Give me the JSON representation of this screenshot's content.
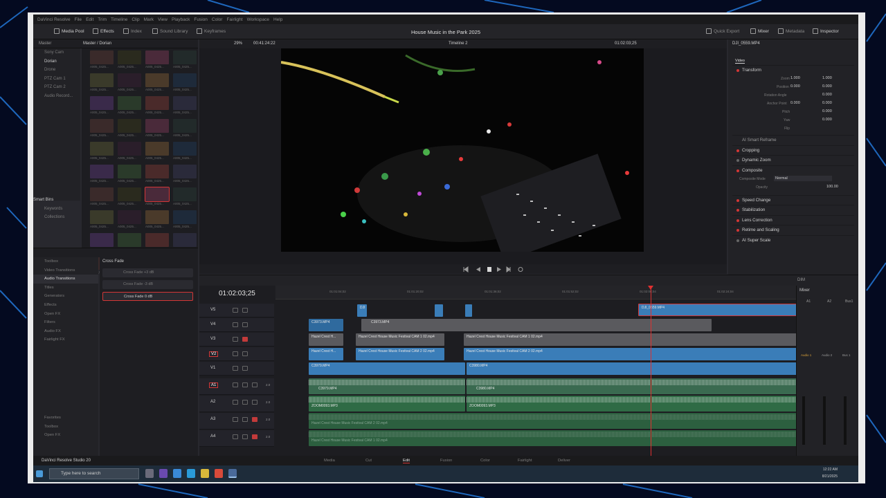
{
  "window": {
    "title_bar": "DaVinci Resolve",
    "menu": [
      "File",
      "Edit",
      "Trim",
      "Timeline",
      "Clip",
      "Mark",
      "View",
      "Playback",
      "Fusion",
      "Color",
      "Fairlight",
      "Workspace",
      "Help"
    ],
    "project_title": "House Music in the Park 2025"
  },
  "toolbar": {
    "media_pool": "Media Pool",
    "effects": "Effects",
    "index": "Index",
    "sound_library": "Sound Library",
    "keyframes": "Keyframes",
    "quick_export": "Quick Export",
    "mixer": "Mixer",
    "metadata": "Metadata",
    "inspector": "Inspector"
  },
  "media_pool": {
    "master": "Master",
    "breadcrumb": "Master / Dorian",
    "bins": [
      "Sony Cam",
      "Dorian",
      "Drone",
      "PTZ Cam 1",
      "PTZ Cam 2",
      "Audio Record..."
    ],
    "smart_bins": "Smart Bins",
    "smart_items": [
      "Keywords",
      "Collections"
    ],
    "clip_label": "A005_0425...",
    "selected_clip_label": "A005_0425..."
  },
  "viewer": {
    "zoom": "29%",
    "source_tc": "00:41:24:22",
    "timeline_name": "Timeline 2",
    "record_tc": "01:02:03;25"
  },
  "effects": {
    "tree": [
      "Toolbox",
      "Video Transitions",
      "Audio Transitions",
      "Titles",
      "Generators",
      "Effects",
      "Open FX",
      "Filters",
      "Audio FX",
      "Fairlight FX",
      "Favorites",
      "Toolbox",
      "Open FX"
    ],
    "category": "Cross Fade",
    "items": [
      "Cross Fade +3 dB",
      "Cross Fade -3 dB",
      "Cross Fade 0 dB"
    ]
  },
  "inspector": {
    "clip_name": "DJI_0559.MP4",
    "tab": "Video",
    "transform": "Transform",
    "zoom_label": "Zoom",
    "zoom_x": "1.000",
    "zoom_y": "1.000",
    "position_label": "Position",
    "pos_x": "0.000",
    "pos_y": "0.000",
    "rotation_label": "Rotation Angle",
    "rotation": "0.000",
    "anchor_label": "Anchor Point",
    "anchor_x": "0.000",
    "anchor_y": "0.000",
    "pitch_label": "Pitch",
    "pitch": "0.000",
    "yaw_label": "Yaw",
    "yaw": "0.000",
    "flip_label": "Flip",
    "ai_reframe": "AI Smart Reframe",
    "sections": [
      "Cropping",
      "Dynamic Zoom",
      "Composite"
    ],
    "composite_mode_label": "Composite Mode",
    "composite_mode": "Normal",
    "opacity_label": "Opacity",
    "opacity": "100.00",
    "sections2": [
      "Speed Change",
      "Stabilization",
      "Lens Correction",
      "Retime and Scaling",
      "AI Super Scale"
    ]
  },
  "timeline": {
    "timecode": "01:02:03;25",
    "ruler": [
      "01:01:04;02",
      "01:01:20;02",
      "01:01:36;02",
      "01:01:52;02",
      "01:02:08;04",
      "01:02:24;04"
    ],
    "tracks": [
      "V5",
      "V4",
      "V3",
      "V2",
      "V1",
      "A1",
      "A2",
      "A3",
      "A4"
    ],
    "vols": [
      "2.0",
      "2.0",
      "2.0",
      "2.0"
    ],
    "clips": {
      "v4a": "C3973.MP4",
      "v4b": "C3973.MP4",
      "v5a": "DJI",
      "v5b": "DJI_0559.MP4",
      "v3a": "Hazel Crest H...",
      "v3b": "Hazel Crest House Music Festival CAM 1 02.mp4",
      "v3c": "Hazel Crest House Music Festival CAM 1 02.mp4",
      "v2a": "Hazel Crest H...",
      "v2b": "Hazel Crest House Music Festival CAM 2 02.mp4",
      "v2c": "Hazel Crest House Music Festival CAM 2 02.mp4",
      "v1a": "C3979.MP4",
      "v1b": "C3980.MP4",
      "a1a": "C3979.MP4",
      "a1b": "C3980.MP4",
      "a2a": "ZOOM0093.MP3",
      "a2b": "ZOOM0093.MP3",
      "a3a": "Hazel Crest House Music Festival CAM 2 02.mp4",
      "a4a": "Hazel Crest House Music Festival CAM 1 02.mp4"
    }
  },
  "mixer": {
    "title": "Mixer",
    "dim": "DIM",
    "channels": [
      "A1",
      "A2",
      "Bus1"
    ],
    "labels": [
      "Audio 1",
      "Audio 2",
      "Bus 1"
    ]
  },
  "pages": [
    "Media",
    "Cut",
    "Edit",
    "Fusion",
    "Color",
    "Fairlight",
    "Deliver"
  ],
  "brand": "DaVinci Resolve Studio 20",
  "taskbar": {
    "search_placeholder": "Type here to search",
    "time": "12:22 AM",
    "date": "8/21/2025"
  }
}
